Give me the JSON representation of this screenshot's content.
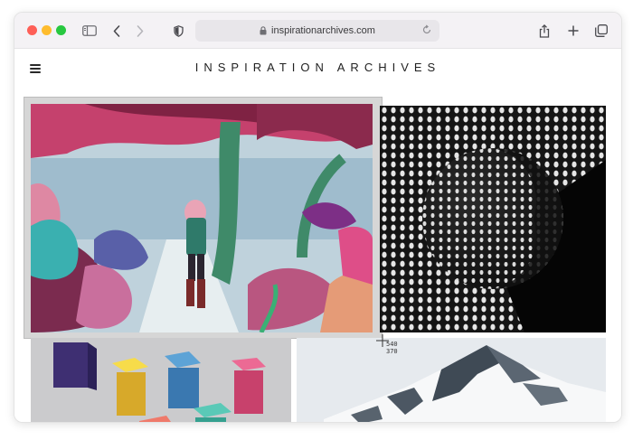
{
  "browser": {
    "url": "inspirationarchives.com",
    "icons": {
      "sidebar": "sidebar-icon",
      "back": "chevron-left-icon",
      "forward": "chevron-right-icon",
      "privacy": "shield-icon",
      "lock": "lock-icon",
      "reload": "reload-icon",
      "share": "share-icon",
      "new_tab": "plus-icon",
      "tab_overview": "tabs-icon"
    }
  },
  "site": {
    "title": "INSPIRATION ARCHIVES",
    "menu_icon": "hamburger-icon"
  },
  "gallery": {
    "tiles": [
      {
        "name": "forest-illustration",
        "kind": "illustration"
      },
      {
        "name": "dotted-sphere",
        "kind": "photo"
      },
      {
        "name": "floating-cubes",
        "kind": "render"
      },
      {
        "name": "snowy-mountain",
        "kind": "photo"
      }
    ]
  },
  "selection_overlay": {
    "readout_x": "540",
    "readout_y": "370"
  },
  "colors": {
    "traffic_red": "#fe5f57",
    "traffic_yellow": "#febc2e",
    "traffic_green": "#28c840",
    "toolbar_bg": "#f4f2f5"
  }
}
